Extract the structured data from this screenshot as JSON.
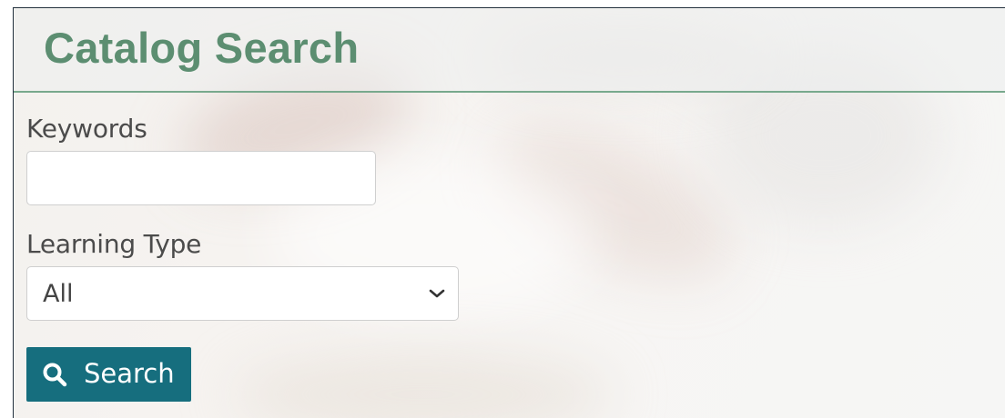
{
  "header": {
    "title": "Catalog Search"
  },
  "form": {
    "keywords": {
      "label": "Keywords",
      "value": ""
    },
    "learning_type": {
      "label": "Learning Type",
      "selected": "All"
    },
    "search_button": {
      "label": "Search",
      "icon": "search-icon"
    }
  },
  "colors": {
    "title": "#5c8e71",
    "header_rule": "#78a98d",
    "button_bg": "#166e7e",
    "button_text": "#ffffff"
  }
}
